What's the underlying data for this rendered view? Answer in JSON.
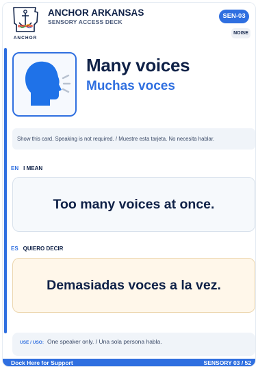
{
  "header": {
    "logo_text": "ANCHOR",
    "title": "ANCHOR ARKANSAS",
    "subtitle": "SENSORY ACCESS DECK",
    "code": "SEN-03",
    "category": "NOISE"
  },
  "hero": {
    "icon": "speaking-head-icon",
    "title": "Many voices",
    "subtitle": "Muchas voces"
  },
  "instruction": "Show this card. Speaking is not required. / Muestre esta tarjeta. No necesita hablar.",
  "english": {
    "code": "EN",
    "label": "I MEAN",
    "phrase": "Too many voices at once."
  },
  "spanish": {
    "code": "ES",
    "label": "QUIERO DECIR",
    "phrase": "Demasiadas voces a la vez."
  },
  "use": {
    "label": "USE / USO:",
    "text": "One speaker only. / Una sola persona habla."
  },
  "footer": {
    "left": "Dock Here for Support",
    "right": "SENSORY 03 / 52"
  },
  "colors": {
    "accent": "#2f6fe0",
    "navy": "#0f2147",
    "cream": "#fff7ea"
  }
}
